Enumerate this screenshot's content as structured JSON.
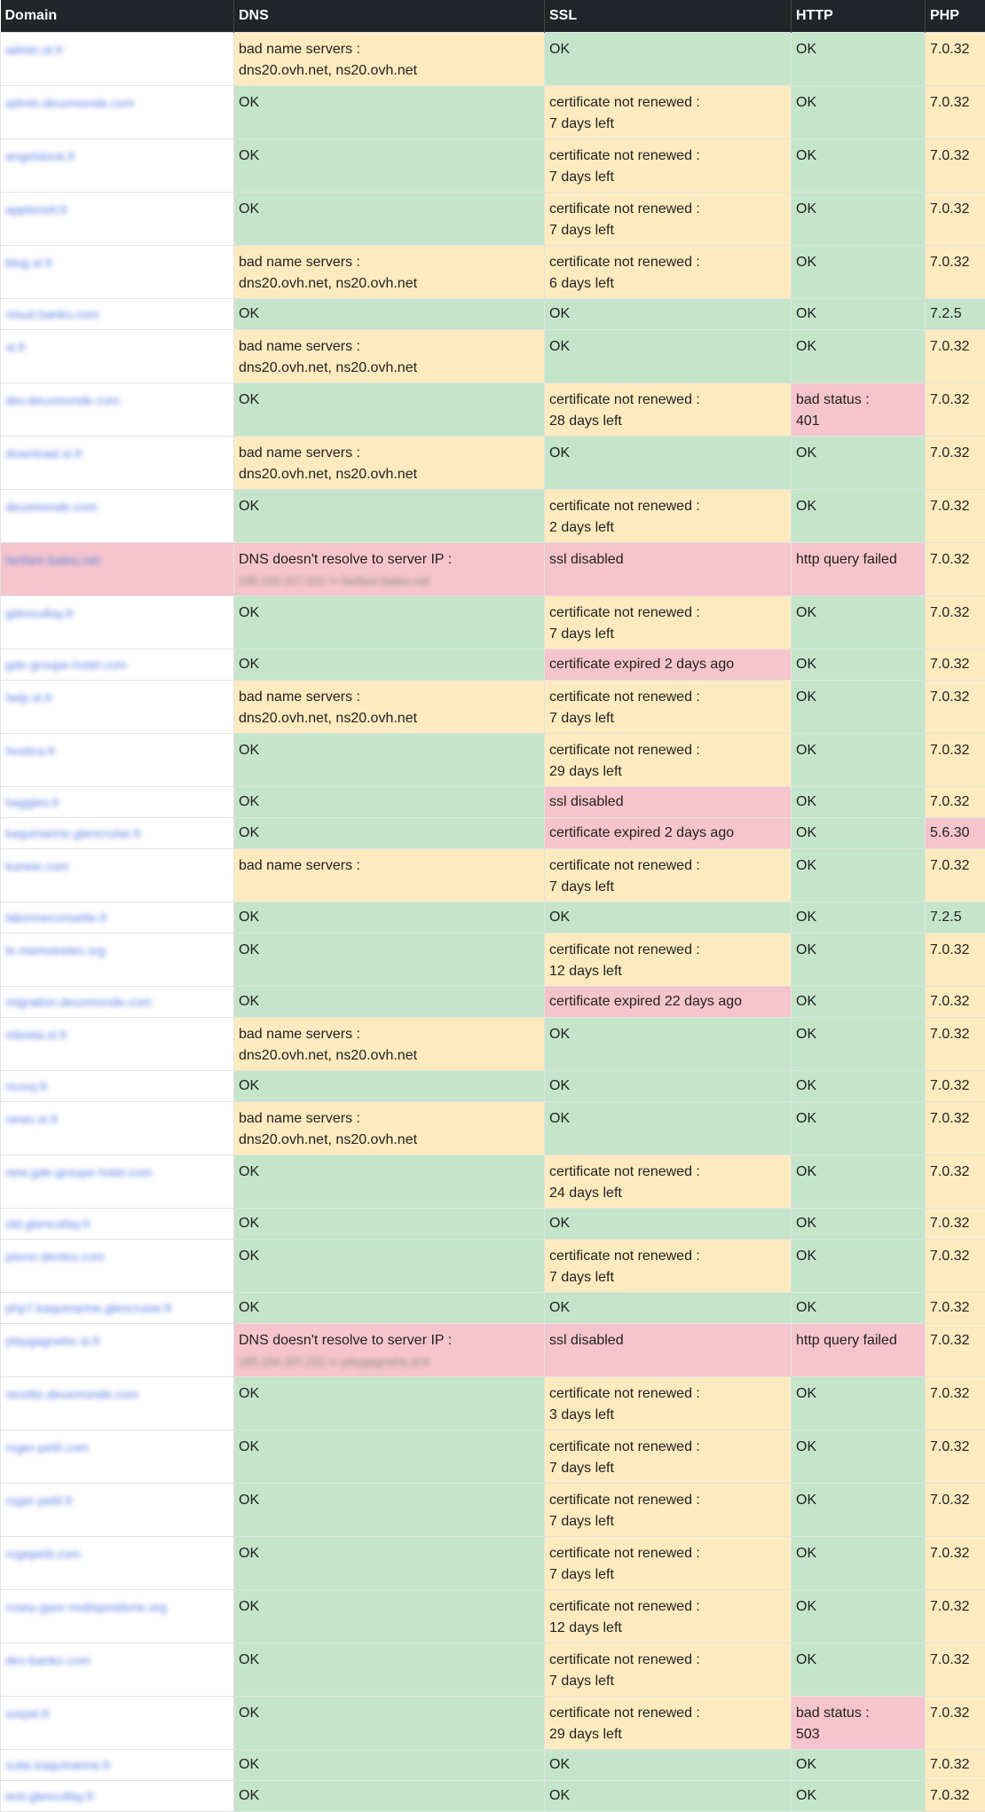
{
  "colors": {
    "header_bg": "#212529",
    "ok": "#c4e5ca",
    "warn": "#fdebbf",
    "error": "#f5c4cc",
    "link": "#5b7fe6"
  },
  "table": {
    "headers": [
      "Domain",
      "DNS",
      "SSL",
      "HTTP",
      "PHP"
    ],
    "rows": [
      {
        "domain": "admin.st.fr",
        "dns": {
          "s": "warn",
          "t": "bad name servers :",
          "t2": "dns20.ovh.net, ns20.ovh.net"
        },
        "ssl": {
          "s": "ok",
          "t": "OK"
        },
        "http": {
          "s": "ok",
          "t": "OK"
        },
        "php": {
          "s": "warn",
          "t": "7.0.32"
        }
      },
      {
        "domain": "admin.deuxmonde.com",
        "dns": {
          "s": "ok",
          "t": "OK"
        },
        "ssl": {
          "s": "warn",
          "t": "certificate not renewed :",
          "t2": "7 days left"
        },
        "http": {
          "s": "ok",
          "t": "OK"
        },
        "php": {
          "s": "warn",
          "t": "7.0.32"
        }
      },
      {
        "domain": "angelstock.fr",
        "dns": {
          "s": "ok",
          "t": "OK"
        },
        "ssl": {
          "s": "warn",
          "t": "certificate not renewed :",
          "t2": "7 days left"
        },
        "http": {
          "s": "ok",
          "t": "OK"
        },
        "php": {
          "s": "warn",
          "t": "7.0.32"
        }
      },
      {
        "domain": "apptenoit.fr",
        "dns": {
          "s": "ok",
          "t": "OK"
        },
        "ssl": {
          "s": "warn",
          "t": "certificate not renewed :",
          "t2": "7 days left"
        },
        "http": {
          "s": "ok",
          "t": "OK"
        },
        "php": {
          "s": "warn",
          "t": "7.0.32"
        }
      },
      {
        "domain": "blog.st.fr",
        "dns": {
          "s": "warn",
          "t": "bad name servers :",
          "t2": "dns20.ovh.net, ns20.ovh.net"
        },
        "ssl": {
          "s": "warn",
          "t": "certificate not renewed :",
          "t2": "6 days left"
        },
        "http": {
          "s": "ok",
          "t": "OK"
        },
        "php": {
          "s": "warn",
          "t": "7.0.32"
        }
      },
      {
        "domain": "cloud.banko.com",
        "dns": {
          "s": "ok",
          "t": "OK"
        },
        "ssl": {
          "s": "ok",
          "t": "OK"
        },
        "http": {
          "s": "ok",
          "t": "OK"
        },
        "php": {
          "s": "ok",
          "t": "7.2.5"
        }
      },
      {
        "domain": "st.fr",
        "dns": {
          "s": "warn",
          "t": "bad name servers :",
          "t2": "dns20.ovh.net, ns20.ovh.net"
        },
        "ssl": {
          "s": "ok",
          "t": "OK"
        },
        "http": {
          "s": "ok",
          "t": "OK"
        },
        "php": {
          "s": "warn",
          "t": "7.0.32"
        }
      },
      {
        "domain": "dev.deuxmonde.com",
        "dns": {
          "s": "ok",
          "t": "OK"
        },
        "ssl": {
          "s": "warn",
          "t": "certificate not renewed :",
          "t2": "28 days left"
        },
        "http": {
          "s": "err",
          "t": "bad status :",
          "t2": "401"
        },
        "php": {
          "s": "warn",
          "t": "7.0.32"
        }
      },
      {
        "domain": "download.st.fr",
        "dns": {
          "s": "warn",
          "t": "bad name servers :",
          "t2": "dns20.ovh.net, ns20.ovh.net"
        },
        "ssl": {
          "s": "ok",
          "t": "OK"
        },
        "http": {
          "s": "ok",
          "t": "OK"
        },
        "php": {
          "s": "warn",
          "t": "7.0.32"
        }
      },
      {
        "domain": "deuxmonde.com",
        "dns": {
          "s": "ok",
          "t": "OK"
        },
        "ssl": {
          "s": "warn",
          "t": "certificate not renewed :",
          "t2": "2 days left"
        },
        "http": {
          "s": "ok",
          "t": "OK"
        },
        "php": {
          "s": "warn",
          "t": "7.0.32"
        }
      },
      {
        "domain": "fanfare-bateu.net",
        "derr": true,
        "dns": {
          "s": "err",
          "t": "DNS doesn't resolve to server IP :",
          "t2": "195.154.207.222 != fanfare-bateu.net",
          "redact": true
        },
        "ssl": {
          "s": "err",
          "t": "ssl disabled"
        },
        "http": {
          "s": "err",
          "t": "http query failed"
        },
        "php": {
          "s": "warn",
          "t": "7.0.32"
        }
      },
      {
        "domain": "gdevcollay.fr",
        "dns": {
          "s": "ok",
          "t": "OK"
        },
        "ssl": {
          "s": "warn",
          "t": "certificate not renewed :",
          "t2": "7 days left"
        },
        "http": {
          "s": "ok",
          "t": "OK"
        },
        "php": {
          "s": "warn",
          "t": "7.0.32"
        }
      },
      {
        "domain": "gde-groupe-hotel.com",
        "dns": {
          "s": "ok",
          "t": "OK"
        },
        "ssl": {
          "s": "err",
          "t": "certificate expired 2 days ago"
        },
        "http": {
          "s": "ok",
          "t": "OK"
        },
        "php": {
          "s": "warn",
          "t": "7.0.32"
        }
      },
      {
        "domain": "help.st.fr",
        "dns": {
          "s": "warn",
          "t": "bad name servers :",
          "t2": "dns20.ovh.net, ns20.ovh.net"
        },
        "ssl": {
          "s": "warn",
          "t": "certificate not renewed :",
          "t2": "7 days left"
        },
        "http": {
          "s": "ok",
          "t": "OK"
        },
        "php": {
          "s": "warn",
          "t": "7.0.32"
        }
      },
      {
        "domain": "hostica.fr",
        "dns": {
          "s": "ok",
          "t": "OK"
        },
        "ssl": {
          "s": "warn",
          "t": "certificate not renewed :",
          "t2": "29 days left"
        },
        "http": {
          "s": "ok",
          "t": "OK"
        },
        "php": {
          "s": "warn",
          "t": "7.0.32"
        }
      },
      {
        "domain": "haggies.fr",
        "dns": {
          "s": "ok",
          "t": "OK"
        },
        "ssl": {
          "s": "err",
          "t": "ssl disabled"
        },
        "http": {
          "s": "ok",
          "t": "OK"
        },
        "php": {
          "s": "warn",
          "t": "7.0.32"
        }
      },
      {
        "domain": "kaqumarine.glencruise.fr",
        "dns": {
          "s": "ok",
          "t": "OK"
        },
        "ssl": {
          "s": "err",
          "t": "certificate expired 2 days ago"
        },
        "http": {
          "s": "ok",
          "t": "OK"
        },
        "php": {
          "s": "err",
          "t": "5.6.30"
        }
      },
      {
        "domain": "kuneie.com",
        "dns": {
          "s": "warn",
          "t": "bad name servers :",
          "t2": ""
        },
        "ssl": {
          "s": "warn",
          "t": "certificate not renewed :",
          "t2": "7 days left"
        },
        "http": {
          "s": "ok",
          "t": "OK"
        },
        "php": {
          "s": "warn",
          "t": "7.0.32"
        }
      },
      {
        "domain": "labonneconsette.fr",
        "dns": {
          "s": "ok",
          "t": "OK"
        },
        "ssl": {
          "s": "ok",
          "t": "OK"
        },
        "http": {
          "s": "ok",
          "t": "OK"
        },
        "php": {
          "s": "ok",
          "t": "7.2.5"
        }
      },
      {
        "domain": "le-memoiretes.org",
        "dns": {
          "s": "ok",
          "t": "OK"
        },
        "ssl": {
          "s": "warn",
          "t": "certificate not renewed :",
          "t2": "12 days left"
        },
        "http": {
          "s": "ok",
          "t": "OK"
        },
        "php": {
          "s": "warn",
          "t": "7.0.32"
        }
      },
      {
        "domain": "migration.deuxmonde.com",
        "dns": {
          "s": "ok",
          "t": "OK"
        },
        "ssl": {
          "s": "err",
          "t": "certificate expired 22 days ago"
        },
        "http": {
          "s": "ok",
          "t": "OK"
        },
        "php": {
          "s": "warn",
          "t": "7.0.32"
        }
      },
      {
        "domain": "mbrela.st.fr",
        "dns": {
          "s": "warn",
          "t": "bad name servers :",
          "t2": "dns20.ovh.net, ns20.ovh.net"
        },
        "ssl": {
          "s": "ok",
          "t": "OK"
        },
        "http": {
          "s": "ok",
          "t": "OK"
        },
        "php": {
          "s": "warn",
          "t": "7.0.32"
        }
      },
      {
        "domain": "ncovy.fr",
        "dns": {
          "s": "ok",
          "t": "OK"
        },
        "ssl": {
          "s": "ok",
          "t": "OK"
        },
        "http": {
          "s": "ok",
          "t": "OK"
        },
        "php": {
          "s": "warn",
          "t": "7.0.32"
        }
      },
      {
        "domain": "news.st.fr",
        "dns": {
          "s": "warn",
          "t": "bad name servers :",
          "t2": "dns20.ovh.net, ns20.ovh.net"
        },
        "ssl": {
          "s": "ok",
          "t": "OK"
        },
        "http": {
          "s": "ok",
          "t": "OK"
        },
        "php": {
          "s": "warn",
          "t": "7.0.32"
        }
      },
      {
        "domain": "new.gde-groupe-hotel.com",
        "dns": {
          "s": "ok",
          "t": "OK"
        },
        "ssl": {
          "s": "warn",
          "t": "certificate not renewed :",
          "t2": "24 days left"
        },
        "http": {
          "s": "ok",
          "t": "OK"
        },
        "php": {
          "s": "warn",
          "t": "7.0.32"
        }
      },
      {
        "domain": "old.glencollay.fr",
        "dns": {
          "s": "ok",
          "t": "OK"
        },
        "ssl": {
          "s": "ok",
          "t": "OK"
        },
        "http": {
          "s": "ok",
          "t": "OK"
        },
        "php": {
          "s": "warn",
          "t": "7.0.32"
        }
      },
      {
        "domain": "pierre.dentes.com",
        "dns": {
          "s": "ok",
          "t": "OK"
        },
        "ssl": {
          "s": "warn",
          "t": "certificate not renewed :",
          "t2": "7 days left"
        },
        "http": {
          "s": "ok",
          "t": "OK"
        },
        "php": {
          "s": "warn",
          "t": "7.0.32"
        }
      },
      {
        "domain": "php7.kaqumarine.glencruise.fr",
        "dns": {
          "s": "ok",
          "t": "OK"
        },
        "ssl": {
          "s": "ok",
          "t": "OK"
        },
        "http": {
          "s": "ok",
          "t": "OK"
        },
        "php": {
          "s": "warn",
          "t": "7.0.32"
        }
      },
      {
        "domain": "playgagnelre.st.fr",
        "dns": {
          "s": "err",
          "t": "DNS doesn't resolve to server IP :",
          "t2": "195.154.207.222 != playgagnelre.st.fr",
          "redact": true
        },
        "ssl": {
          "s": "err",
          "t": "ssl disabled"
        },
        "http": {
          "s": "err",
          "t": "http query failed"
        },
        "php": {
          "s": "warn",
          "t": "7.0.32"
        }
      },
      {
        "domain": "recette.deuxmonde.com",
        "dns": {
          "s": "ok",
          "t": "OK"
        },
        "ssl": {
          "s": "warn",
          "t": "certificate not renewed :",
          "t2": "3 days left"
        },
        "http": {
          "s": "ok",
          "t": "OK"
        },
        "php": {
          "s": "warn",
          "t": "7.0.32"
        }
      },
      {
        "domain": "roger-petit.com",
        "dns": {
          "s": "ok",
          "t": "OK"
        },
        "ssl": {
          "s": "warn",
          "t": "certificate not renewed :",
          "t2": "7 days left"
        },
        "http": {
          "s": "ok",
          "t": "OK"
        },
        "php": {
          "s": "warn",
          "t": "7.0.32"
        }
      },
      {
        "domain": "roger-petit.fr",
        "dns": {
          "s": "ok",
          "t": "OK"
        },
        "ssl": {
          "s": "warn",
          "t": "certificate not renewed :",
          "t2": "7 days left"
        },
        "http": {
          "s": "ok",
          "t": "OK"
        },
        "php": {
          "s": "warn",
          "t": "7.0.32"
        }
      },
      {
        "domain": "rogepetit.com",
        "dns": {
          "s": "ok",
          "t": "OK"
        },
        "ssl": {
          "s": "warn",
          "t": "certificate not renewed :",
          "t2": "7 days left"
        },
        "http": {
          "s": "ok",
          "t": "OK"
        },
        "php": {
          "s": "warn",
          "t": "7.0.32"
        }
      },
      {
        "domain": "rosey-gare-nodispositorie.org",
        "dns": {
          "s": "ok",
          "t": "OK"
        },
        "ssl": {
          "s": "warn",
          "t": "certificate not renewed :",
          "t2": "12 days left"
        },
        "http": {
          "s": "ok",
          "t": "OK"
        },
        "php": {
          "s": "warn",
          "t": "7.0.32"
        }
      },
      {
        "domain": "dev-banko.com",
        "dns": {
          "s": "ok",
          "t": "OK"
        },
        "ssl": {
          "s": "warn",
          "t": "certificate not renewed :",
          "t2": "7 days left"
        },
        "http": {
          "s": "ok",
          "t": "OK"
        },
        "php": {
          "s": "warn",
          "t": "7.0.32"
        }
      },
      {
        "domain": "sorpel.fr",
        "dns": {
          "s": "ok",
          "t": "OK"
        },
        "ssl": {
          "s": "warn",
          "t": "certificate not renewed :",
          "t2": "29 days left"
        },
        "http": {
          "s": "err",
          "t": "bad status :",
          "t2": "503"
        },
        "php": {
          "s": "warn",
          "t": "7.0.32"
        }
      },
      {
        "domain": "suite.kaqumarine.fr",
        "dns": {
          "s": "ok",
          "t": "OK"
        },
        "ssl": {
          "s": "ok",
          "t": "OK"
        },
        "http": {
          "s": "ok",
          "t": "OK"
        },
        "php": {
          "s": "warn",
          "t": "7.0.32"
        }
      },
      {
        "domain": "test.glencollay.fr",
        "dns": {
          "s": "ok",
          "t": "OK"
        },
        "ssl": {
          "s": "ok",
          "t": "OK"
        },
        "http": {
          "s": "ok",
          "t": "OK"
        },
        "php": {
          "s": "warn",
          "t": "7.0.32"
        }
      }
    ]
  }
}
